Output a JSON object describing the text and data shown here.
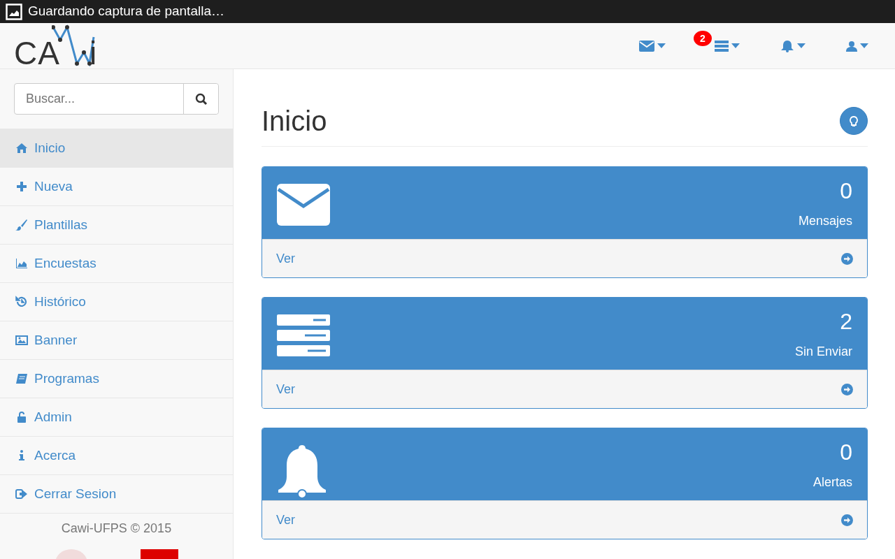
{
  "status_bar": {
    "text": "Guardando captura de pantalla…"
  },
  "logo": {
    "left": "CA",
    "right": "i"
  },
  "navbar": {
    "tasks_badge": "2"
  },
  "search": {
    "placeholder": "Buscar..."
  },
  "sidebar": {
    "items": [
      {
        "label": "Inicio",
        "selected": true
      },
      {
        "label": "Nueva",
        "selected": false
      },
      {
        "label": "Plantillas",
        "selected": false
      },
      {
        "label": "Encuestas",
        "selected": false
      },
      {
        "label": "Histórico",
        "selected": false
      },
      {
        "label": "Banner",
        "selected": false
      },
      {
        "label": "Programas",
        "selected": false
      },
      {
        "label": "Admin",
        "selected": false
      },
      {
        "label": "Acerca",
        "selected": false
      },
      {
        "label": "Cerrar Sesion",
        "selected": false
      }
    ],
    "footer": "Cawi-UFPS © 2015"
  },
  "page": {
    "title": "Inicio"
  },
  "panels": [
    {
      "count": "0",
      "label": "Mensajes",
      "link": "Ver"
    },
    {
      "count": "2",
      "label": "Sin Enviar",
      "link": "Ver"
    },
    {
      "count": "0",
      "label": "Alertas",
      "link": "Ver"
    }
  ]
}
